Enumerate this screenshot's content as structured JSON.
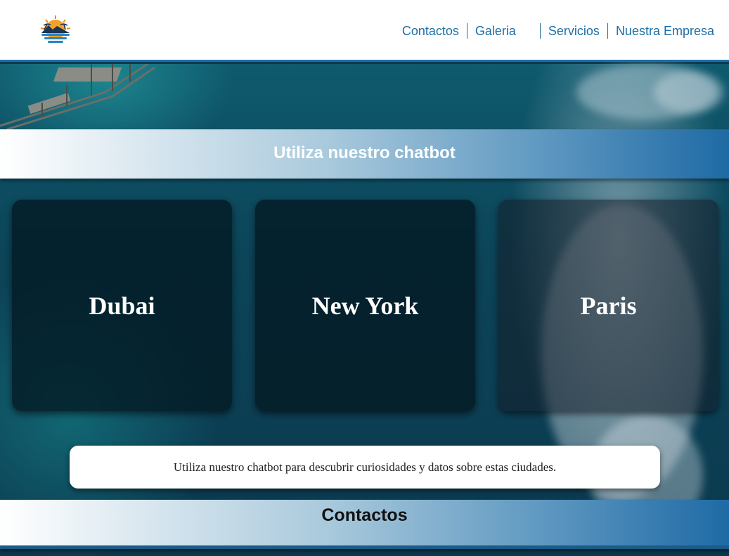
{
  "header": {
    "logo_icon": "beach-sunset-logo-icon",
    "nav": [
      "Contactos",
      "Galeria",
      "Servicios",
      "Nuestra Empresa"
    ]
  },
  "chatbot_banner": {
    "title": "Utiliza nuestro chatbot"
  },
  "cities": [
    {
      "name": "Dubai"
    },
    {
      "name": "New York"
    },
    {
      "name": "Paris"
    }
  ],
  "info": {
    "text": "Utiliza nuestro chatbot para descubrir curiosidades y datos sobre estas ciudades."
  },
  "contact_banner": {
    "title": "Contactos"
  },
  "colors": {
    "brand_blue": "#1d6fa8",
    "ocean": "#0c4458",
    "card": "#031821"
  }
}
